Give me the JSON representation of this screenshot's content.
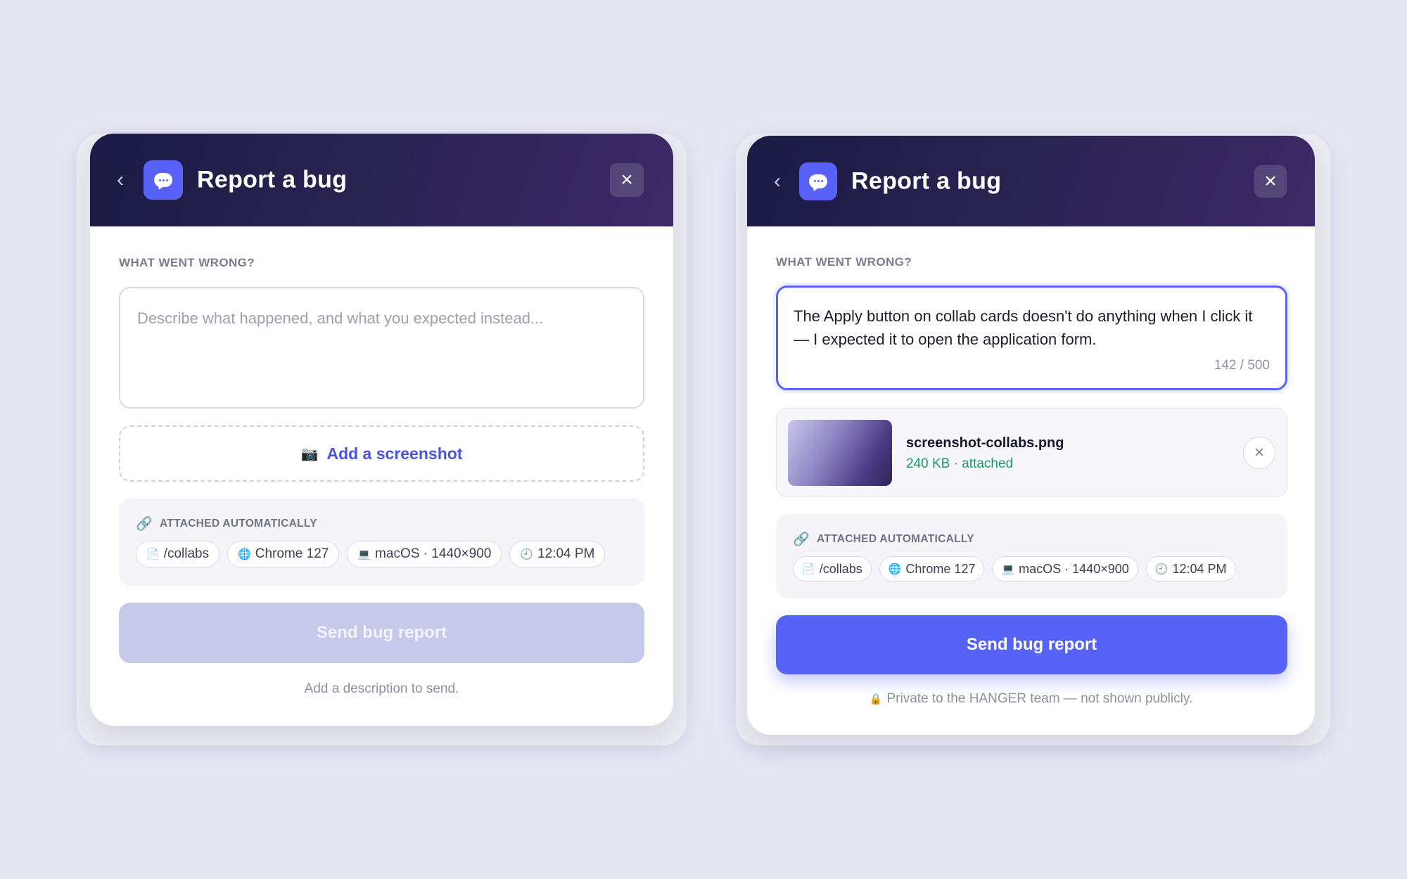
{
  "colors": {
    "background": "#e7e7f4",
    "accent": "#5862f8",
    "header_from": "#1b1b45",
    "header_to": "#3d2a68",
    "success": "#1a9a62",
    "disabled_button": "#c7c9ea"
  },
  "left_card": {
    "header": {
      "back_icon": "chevron-left-icon",
      "app_icon": "chat-bubble-icon",
      "title": "Report a bug",
      "close_icon": "close-icon"
    },
    "section_label": "WHAT WENT WRONG?",
    "textarea": {
      "value": "",
      "placeholder": "Describe what happened, and what you expected instead..."
    },
    "screenshot_button": {
      "icon": "camera-icon",
      "label": "Add a screenshot"
    },
    "auto_attached": {
      "icon": "link-icon",
      "label": "ATTACHED AUTOMATICALLY",
      "chips": [
        {
          "icon": "file-icon",
          "label": "/collabs"
        },
        {
          "icon": "globe-icon",
          "label": "Chrome 127"
        },
        {
          "icon": "laptop-icon",
          "label": "macOS · 1440×900"
        },
        {
          "icon": "clock-icon",
          "label": "12:04 PM"
        }
      ]
    },
    "send_button": {
      "label": "Send bug report",
      "state": "disabled"
    },
    "hint": "Add a description to send."
  },
  "right_card": {
    "header": {
      "back_icon": "chevron-left-icon",
      "app_icon": "chat-bubble-icon",
      "title": "Report a bug",
      "close_icon": "close-icon"
    },
    "section_label": "WHAT WENT WRONG?",
    "textarea": {
      "value": "The Apply button on collab cards doesn't do anything when I click it — I expected it to open the application form.",
      "counter": "142 / 500"
    },
    "attachment": {
      "file_name": "screenshot-collabs.png",
      "meta": "240 KB · attached",
      "remove_icon": "close-icon"
    },
    "auto_attached": {
      "icon": "link-icon",
      "label": "ATTACHED AUTOMATICALLY",
      "chips": [
        {
          "icon": "file-icon",
          "label": "/collabs"
        },
        {
          "icon": "globe-icon",
          "label": "Chrome 127"
        },
        {
          "icon": "laptop-icon",
          "label": "macOS · 1440×900"
        },
        {
          "icon": "clock-icon",
          "label": "12:04 PM"
        }
      ]
    },
    "send_button": {
      "label": "Send bug report",
      "state": "enabled"
    },
    "hint": {
      "icon": "lock-icon",
      "text": "Private to the HANGER team — not shown publicly."
    }
  }
}
